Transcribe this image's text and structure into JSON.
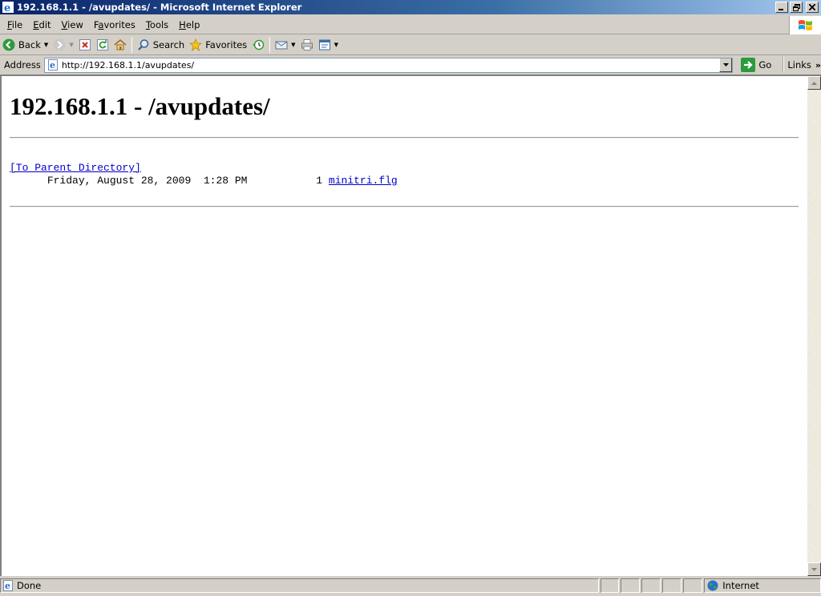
{
  "window": {
    "title": "192.168.1.1 - /avupdates/ - Microsoft Internet Explorer"
  },
  "menu": {
    "file": "File",
    "file_key": "F",
    "edit": "Edit",
    "edit_key": "E",
    "view": "View",
    "view_key": "V",
    "favorites": "Favorites",
    "favorites_key": "a",
    "tools": "Tools",
    "tools_key": "T",
    "help": "Help",
    "help_key": "H"
  },
  "toolbar": {
    "back": "Back",
    "search": "Search",
    "favorites": "Favorites"
  },
  "address": {
    "label": "Address",
    "url": "http://192.168.1.1/avupdates/",
    "go": "Go",
    "links": "Links"
  },
  "page": {
    "heading": "192.168.1.1 - /avupdates/",
    "parent_link": "[To Parent Directory]",
    "entries": [
      {
        "date": "Friday, August 28, 2009  1:28 PM",
        "size": "1",
        "name": "minitri.flg"
      }
    ]
  },
  "status": {
    "text": "Done",
    "zone": "Internet"
  },
  "colors": {
    "titlebar_start": "#0a246a",
    "link": "#0000cc"
  }
}
